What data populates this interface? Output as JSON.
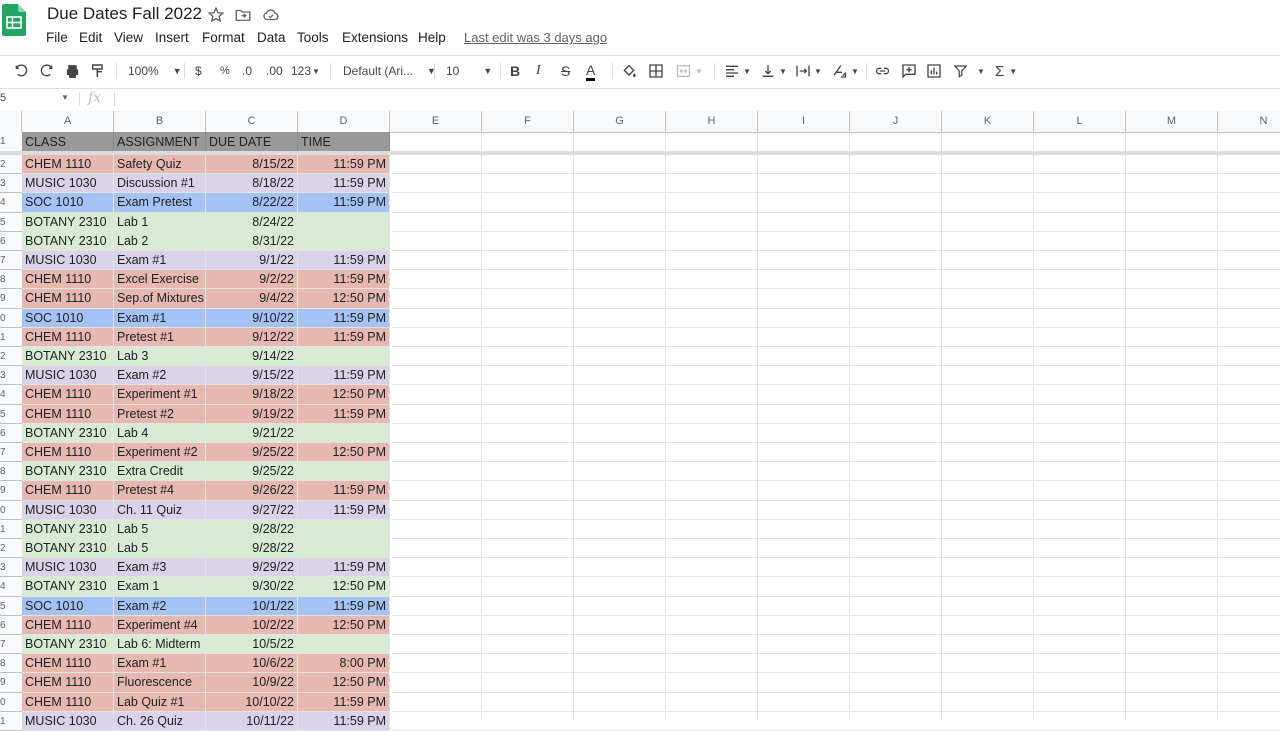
{
  "app": {
    "title": "Due Dates Fall 2022",
    "icons": [
      "sheets-logo-icon",
      "star-icon",
      "move-folder-icon",
      "cloud-status-icon"
    ],
    "menu": [
      "File",
      "Edit",
      "View",
      "Insert",
      "Format",
      "Data",
      "Tools",
      "Extensions",
      "Help"
    ],
    "last_edit": "Last edit was 3 days ago"
  },
  "toolbar": {
    "zoom": "100%",
    "currency": "$",
    "percent": "%",
    "dec_decrease": ".0",
    "dec_increase": ".00",
    "more_formats": "123",
    "font": "Default (Ari...",
    "font_size": "10",
    "bold": "B",
    "italic": "I",
    "strike": "S",
    "text_color": "A",
    "sum": "Σ"
  },
  "formula_bar": {
    "name_box": "5",
    "fx": "fx",
    "content": ""
  },
  "columns": [
    "A",
    "B",
    "C",
    "D",
    "E",
    "F",
    "G",
    "H",
    "I",
    "J",
    "K",
    "L",
    "M",
    "N"
  ],
  "colors": {
    "header": "#999999",
    "CHEM": "#e6b8af",
    "MUSIC": "#d9d2e9",
    "SOC": "#a4c2f4",
    "BOTANY": "#d9ead3"
  },
  "table": {
    "headers": [
      "CLASS",
      "ASSIGNMENT",
      "DUE DATE",
      "TIME"
    ],
    "row_numbers": [
      "1",
      "2",
      "3",
      "4",
      "5",
      "6",
      "7",
      "8",
      "9",
      "0",
      "1",
      "2",
      "3",
      "4",
      "5",
      "6",
      "7",
      "8",
      "9",
      "0",
      "1",
      "2",
      "3",
      "4",
      "5",
      "6",
      "7",
      "8",
      "9",
      "0",
      "1"
    ],
    "rows": [
      {
        "class": "CHEM 1110",
        "assignment": "Safety Quiz",
        "date": "8/15/22",
        "time": "11:59 PM",
        "color": "#e6b8af"
      },
      {
        "class": "MUSIC 1030",
        "assignment": "Discussion #1",
        "date": "8/18/22",
        "time": "11:59 PM",
        "color": "#d9d2e9"
      },
      {
        "class": "SOC 1010",
        "assignment": "Exam Pretest",
        "date": "8/22/22",
        "time": "11:59 PM",
        "color": "#a4c2f4"
      },
      {
        "class": "BOTANY 2310",
        "assignment": "Lab 1",
        "date": "8/24/22",
        "time": "",
        "color": "#d9ead3"
      },
      {
        "class": "BOTANY 2310",
        "assignment": "Lab 2",
        "date": "8/31/22",
        "time": "",
        "color": "#d9ead3"
      },
      {
        "class": "MUSIC 1030",
        "assignment": "Exam #1",
        "date": "9/1/22",
        "time": "11:59 PM",
        "color": "#d9d2e9"
      },
      {
        "class": "CHEM 1110",
        "assignment": "Excel Exercise",
        "date": "9/2/22",
        "time": "11:59 PM",
        "color": "#e6b8af"
      },
      {
        "class": "CHEM 1110",
        "assignment": "Sep.of Mixtures",
        "date": "9/4/22",
        "time": "12:50 PM",
        "color": "#e6b8af"
      },
      {
        "class": "SOC 1010",
        "assignment": "Exam #1",
        "date": "9/10/22",
        "time": "11:59 PM",
        "color": "#a4c2f4"
      },
      {
        "class": "CHEM 1110",
        "assignment": "Pretest #1",
        "date": "9/12/22",
        "time": "11:59 PM",
        "color": "#e6b8af"
      },
      {
        "class": "BOTANY 2310",
        "assignment": "Lab 3",
        "date": "9/14/22",
        "time": "",
        "color": "#d9ead3"
      },
      {
        "class": "MUSIC 1030",
        "assignment": "Exam #2",
        "date": "9/15/22",
        "time": "11:59 PM",
        "color": "#d9d2e9"
      },
      {
        "class": "CHEM 1110",
        "assignment": "Experiment #1",
        "date": "9/18/22",
        "time": "12:50 PM",
        "color": "#e6b8af"
      },
      {
        "class": "CHEM 1110",
        "assignment": "Pretest #2",
        "date": "9/19/22",
        "time": "11:59 PM",
        "color": "#e6b8af"
      },
      {
        "class": "BOTANY 2310",
        "assignment": "Lab 4",
        "date": "9/21/22",
        "time": "",
        "color": "#d9ead3"
      },
      {
        "class": "CHEM 1110",
        "assignment": "Experiment #2",
        "date": "9/25/22",
        "time": "12:50 PM",
        "color": "#e6b8af"
      },
      {
        "class": "BOTANY 2310",
        "assignment": "Extra Credit",
        "date": "9/25/22",
        "time": "",
        "color": "#d9ead3"
      },
      {
        "class": "CHEM 1110",
        "assignment": "Pretest #4",
        "date": "9/26/22",
        "time": "11:59 PM",
        "color": "#e6b8af"
      },
      {
        "class": "MUSIC 1030",
        "assignment": "Ch. 11 Quiz",
        "date": "9/27/22",
        "time": "11:59 PM",
        "color": "#d9d2e9"
      },
      {
        "class": "BOTANY 2310",
        "assignment": "Lab 5",
        "date": "9/28/22",
        "time": "",
        "color": "#d9ead3"
      },
      {
        "class": "BOTANY 2310",
        "assignment": "Lab 5",
        "date": "9/28/22",
        "time": "",
        "color": "#d9ead3"
      },
      {
        "class": "MUSIC 1030",
        "assignment": "Exam #3",
        "date": "9/29/22",
        "time": "11:59 PM",
        "color": "#d9d2e9"
      },
      {
        "class": "BOTANY 2310",
        "assignment": "Exam 1",
        "date": "9/30/22",
        "time": "12:50 PM",
        "color": "#d9ead3"
      },
      {
        "class": "SOC 1010",
        "assignment": "Exam #2",
        "date": "10/1/22",
        "time": "11:59 PM",
        "color": "#a4c2f4"
      },
      {
        "class": "CHEM 1110",
        "assignment": "Experiment #4",
        "date": "10/2/22",
        "time": "12:50 PM",
        "color": "#e6b8af"
      },
      {
        "class": "BOTANY 2310",
        "assignment": "Lab 6: Midterm",
        "date": "10/5/22",
        "time": "",
        "color": "#d9ead3"
      },
      {
        "class": "CHEM 1110",
        "assignment": "Exam #1",
        "date": "10/6/22",
        "time": "8:00 PM",
        "color": "#e6b8af"
      },
      {
        "class": "CHEM 1110",
        "assignment": "Fluorescence",
        "date": "10/9/22",
        "time": "12:50 PM",
        "color": "#e6b8af"
      },
      {
        "class": "CHEM 1110",
        "assignment": "Lab Quiz #1",
        "date": "10/10/22",
        "time": "11:59 PM",
        "color": "#e6b8af"
      },
      {
        "class": "MUSIC 1030",
        "assignment": "Ch. 26 Quiz",
        "date": "10/11/22",
        "time": "11:59 PM",
        "color": "#d9d2e9"
      }
    ]
  }
}
